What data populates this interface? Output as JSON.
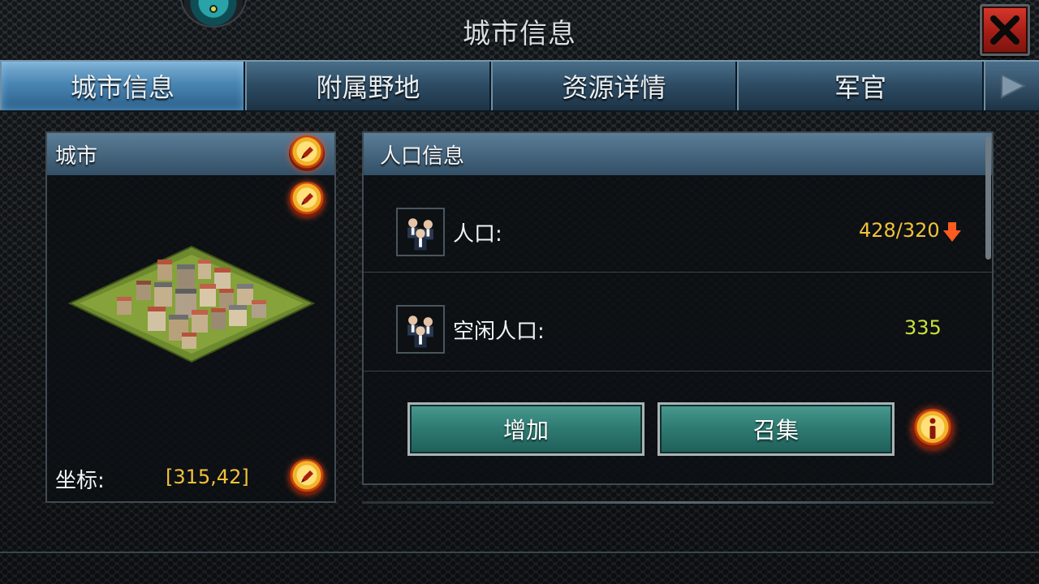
{
  "header": {
    "title": "城市信息",
    "close_icon": "close-x-icon"
  },
  "tabs": [
    {
      "label": "城市信息",
      "active": true
    },
    {
      "label": "附属野地",
      "active": false
    },
    {
      "label": "资源详情",
      "active": false
    },
    {
      "label": "军官",
      "active": false
    }
  ],
  "city_panel": {
    "title": "城市",
    "coord_label": "坐标:",
    "coord_value": "[315,42]"
  },
  "population_panel": {
    "title": "人口信息",
    "rows": [
      {
        "label": "人口:",
        "value": "428/320",
        "value_color": "#f3c23a",
        "trend": "down"
      },
      {
        "label": "空闲人口:",
        "value": "335",
        "value_color": "#c7e23a"
      }
    ],
    "buttons": {
      "increase": "增加",
      "gather": "召集"
    }
  },
  "colors": {
    "accent_warning": "#ff5a1f",
    "tab_active": "#4a86b3",
    "button_teal": "#2f7c73"
  }
}
